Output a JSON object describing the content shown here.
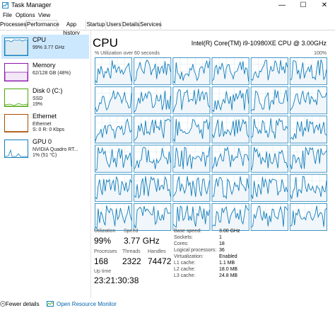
{
  "window": {
    "title": "Task Manager",
    "minimize": "—",
    "maximize": "☐",
    "close": "✕"
  },
  "menu": [
    "File",
    "Options",
    "View"
  ],
  "tabs": [
    "Processes",
    "Performance",
    "App history",
    "Startup",
    "Users",
    "Details",
    "Services"
  ],
  "active_tab": "Performance",
  "sidebar": {
    "items": [
      {
        "name": "CPU",
        "lines": [
          "99% 3.77 GHz"
        ],
        "color": "#117dbb"
      },
      {
        "name": "Memory",
        "lines": [
          "62/128 GB (48%)"
        ],
        "color": "#8b12ae"
      },
      {
        "name": "Disk 0 (C:)",
        "lines": [
          "SSD",
          "19%"
        ],
        "color": "#4da60c"
      },
      {
        "name": "Ethernet",
        "lines": [
          "Ethernet",
          "S: 0 R: 0 Kbps"
        ],
        "color": "#a74f01"
      },
      {
        "name": "GPU 0",
        "lines": [
          "NVIDIA Quadro RT...",
          "1% (51 °C)"
        ],
        "color": "#117dbb"
      }
    ]
  },
  "cpu": {
    "title": "CPU",
    "model": "Intel(R) Core(TM) i9-10980XE CPU @ 3.00GHz",
    "util_label": "% Utilization over 60 seconds",
    "util_max": "100%",
    "graph_color": "#117dbb",
    "grid_color": "#d9eaf4",
    "logical_graphs": 36
  },
  "stats": {
    "utilization_label": "Utilization",
    "utilization": "99%",
    "speed_label": "Speed",
    "speed": "3.77 GHz",
    "processes_label": "Processes",
    "processes": "168",
    "threads_label": "Threads",
    "threads": "2322",
    "handles_label": "Handles",
    "handles": "74472",
    "uptime_label": "Up time",
    "uptime": "23:21:30:38"
  },
  "properties": [
    {
      "label": "Base speed:",
      "value": "3.00 GHz"
    },
    {
      "label": "Sockets:",
      "value": "1"
    },
    {
      "label": "Cores:",
      "value": "18"
    },
    {
      "label": "Logical processors:",
      "value": "36"
    },
    {
      "label": "Virtualization:",
      "value": "Enabled"
    },
    {
      "label": "L1 cache:",
      "value": "1.1 MB"
    },
    {
      "label": "L2 cache:",
      "value": "18.0 MB"
    },
    {
      "label": "L3 cache:",
      "value": "24.8 MB"
    }
  ],
  "footer": {
    "fewer_details": "Fewer details",
    "resource_monitor": "Open Resource Monitor"
  }
}
